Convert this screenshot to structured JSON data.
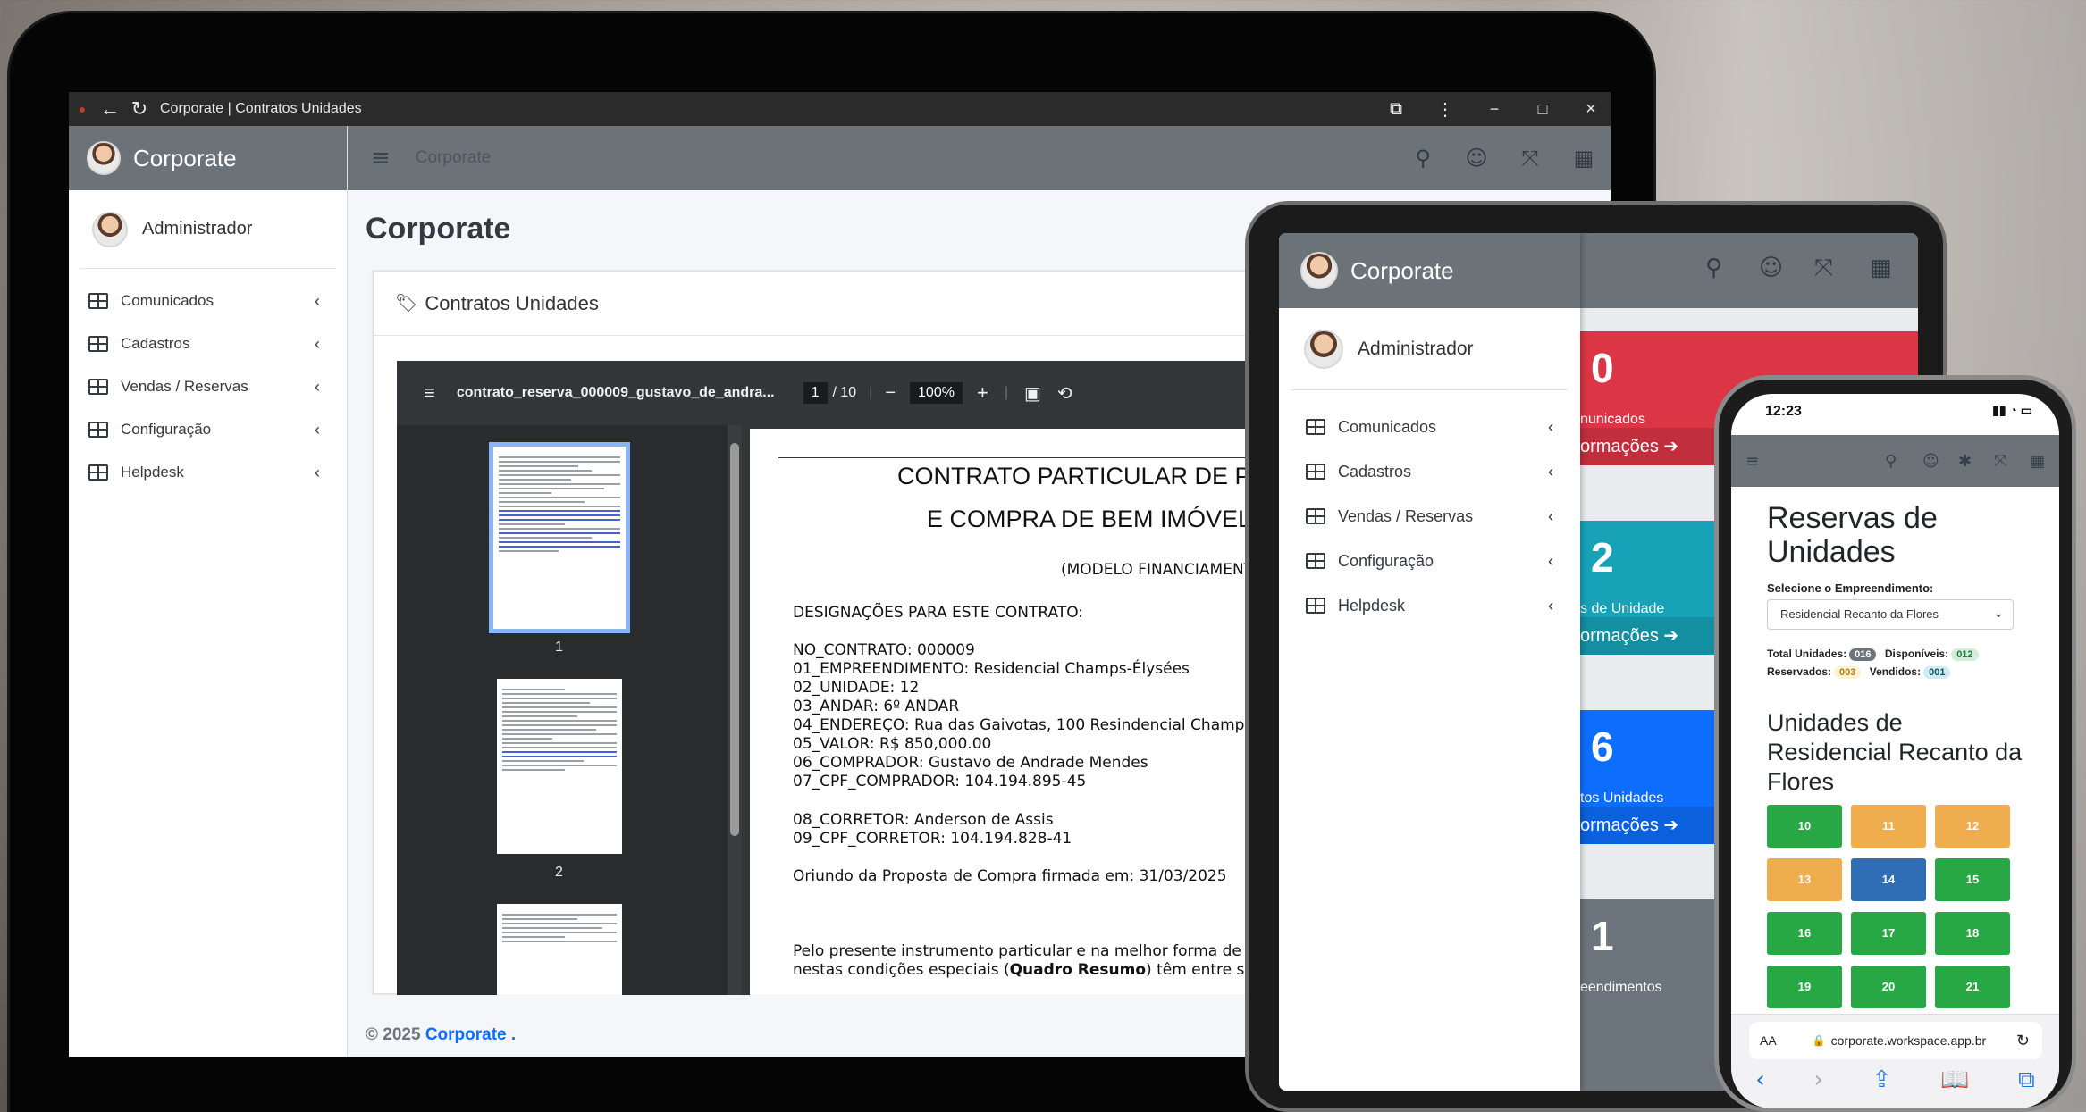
{
  "browser": {
    "tab_title": "Corporate | Contratos Unidades"
  },
  "app": {
    "brand": "Corporate",
    "user": "Administrador",
    "header_title": "Corporate",
    "page_title": "Corporate",
    "card_title": "Contratos Unidades",
    "menu": [
      {
        "label": "Comunicados"
      },
      {
        "label": "Cadastros"
      },
      {
        "label": "Vendas / Reservas"
      },
      {
        "label": "Configuração"
      },
      {
        "label": "Helpdesk"
      }
    ],
    "footer_prefix": "© 2025",
    "footer_brand": "Corporate",
    "footer_suffix": "."
  },
  "pdf": {
    "filename": "contrato_reserva_000009_gustavo_de_andra...",
    "page": "1",
    "pages": "/ 10",
    "zoom": "100%",
    "thumb_labels": [
      "1",
      "2"
    ],
    "doc": {
      "title1": "CONTRATO PARTICULAR DE P",
      "title2": "E COMPRA DE BEM IMÓVEL",
      "model": "(MODELO FINANCIAMENTO",
      "designations": "DESIGNAÇÕES PARA ESTE CONTRATO:",
      "fields": [
        "NO_CONTRATO: 000009",
        "01_EMPREENDIMENTO: Residencial Champs-Élysées",
        "02_UNIDADE: 12",
        "03_ANDAR: 6º ANDAR",
        "04_ENDEREÇO: Rua das Gaivotas, 100 Resindencial Champs-",
        "05_VALOR: R$ 850,000.00",
        "06_COMPRADOR: Gustavo de Andrade Mendes",
        "07_CPF_COMPRADOR: 104.194.895-45"
      ],
      "broker_fields": [
        "08_CORRETOR: Anderson de Assis",
        "09_CPF_CORRETOR: 104.194.828-41"
      ],
      "origin": "Oriundo da Proposta de Compra firmada em: 31/03/2025",
      "para1": "Pelo presente instrumento particular e na melhor forma de d",
      "para2_a": "nestas condições especiais (",
      "para2_bold": "Quadro Resumo",
      "para2_b": ") têm entre si j"
    }
  },
  "tablet": {
    "brand": "Corporate",
    "user": "Administrador",
    "menu": [
      {
        "label": "Comunicados"
      },
      {
        "label": "Cadastros"
      },
      {
        "label": "Vendas / Reservas"
      },
      {
        "label": "Configuração"
      },
      {
        "label": "Helpdesk"
      }
    ],
    "tiles": [
      {
        "num": "0",
        "label": "nunicados",
        "more": "ormações",
        "color": "#dc3545"
      },
      {
        "num": "2",
        "label": "s de Unidade",
        "more": "ormações",
        "color": "#17a2b8"
      },
      {
        "num": "6",
        "label": "tos Unidades",
        "more": "ormações",
        "color": "#0d6efd"
      },
      {
        "num": "1",
        "label": "eendimentos",
        "more": "",
        "color": "#6c757d"
      }
    ]
  },
  "phone": {
    "time": "12:23",
    "heading": "Reservas de Unidades",
    "select_label": "Selecione o Empreendimento:",
    "select_value": "Residencial Recanto da Flores",
    "stats": {
      "total_label": "Total Unidades:",
      "total": "016",
      "disp_label": "Disponíveis:",
      "disp": "012",
      "res_label": "Reservados:",
      "res": "003",
      "vend_label": "Vendidos:",
      "vend": "001"
    },
    "units_heading": "Unidades de Residencial Recanto da Flores",
    "units": [
      {
        "n": "10",
        "color": "#28a745"
      },
      {
        "n": "11",
        "color": "#f0ad4e"
      },
      {
        "n": "12",
        "color": "#f0ad4e"
      },
      {
        "n": "13",
        "color": "#f0ad4e"
      },
      {
        "n": "14",
        "color": "#2f6eb5"
      },
      {
        "n": "15",
        "color": "#28a745"
      },
      {
        "n": "16",
        "color": "#28a745"
      },
      {
        "n": "17",
        "color": "#28a745"
      },
      {
        "n": "18",
        "color": "#28a745"
      },
      {
        "n": "19",
        "color": "#28a745"
      },
      {
        "n": "20",
        "color": "#28a745"
      },
      {
        "n": "21",
        "color": "#28a745"
      }
    ],
    "addr_aa": "AA",
    "addr_url": "corporate.workspace.app.br"
  }
}
